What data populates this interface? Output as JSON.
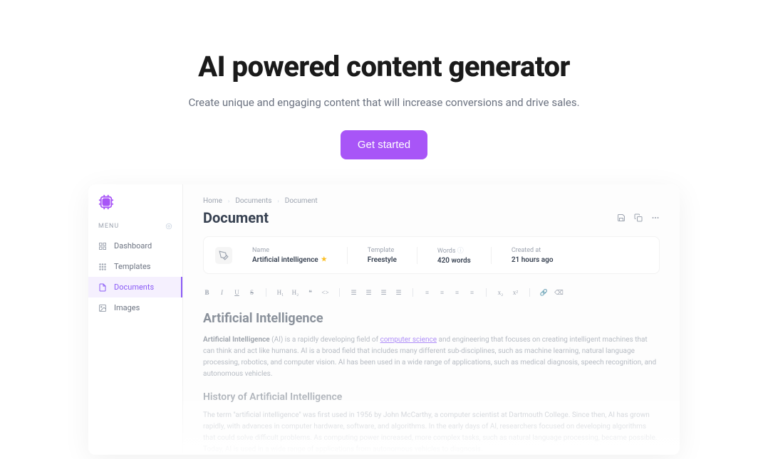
{
  "hero": {
    "title": "AI powered content generator",
    "subtitle": "Create unique and engaging content that will increase conversions and drive sales.",
    "cta": "Get started"
  },
  "sidebar": {
    "menu_label": "MENU",
    "items": [
      {
        "label": "Dashboard"
      },
      {
        "label": "Templates"
      },
      {
        "label": "Documents"
      },
      {
        "label": "Images"
      }
    ]
  },
  "breadcrumbs": {
    "home": "Home",
    "documents": "Documents",
    "current": "Document"
  },
  "page_title": "Document",
  "meta": {
    "name_label": "Name",
    "name_value": "Artificial intelligence",
    "template_label": "Template",
    "template_value": "Freestyle",
    "words_label": "Words",
    "words_value": "420 words",
    "created_label": "Created at",
    "created_value": "21 hours ago"
  },
  "doc": {
    "h1": "Artificial Intelligence",
    "p1_bold": "Artificial Intelligence",
    "p1_pre": " (AI) is a rapidly developing field of ",
    "p1_link": "computer science",
    "p1_post": " and engineering that focuses on creating intelligent machines that can think and act like humans. AI is a broad field that includes many different sub-disciplines, such as machine learning, natural language processing, robotics, and computer vision. AI has been used in a wide range of applications, such as medical diagnosis, speech recognition, and autonomous vehicles.",
    "h2": "History of Artificial Intelligence",
    "p2": "The term \"artificial intelligence\" was first used in 1956 by John McCarthy, a computer scientist at Dartmouth College. Since then, AI has grown rapidly, with advances in computer hardware, software, and algorithms. In the early days of AI, researchers focused on developing algorithms that could solve difficult problems. As computing power increased, more complex tasks, such as natural language processing, became possible. Today, AI is used in a wide range of applications from autonomous vehicles to diagnosis."
  }
}
